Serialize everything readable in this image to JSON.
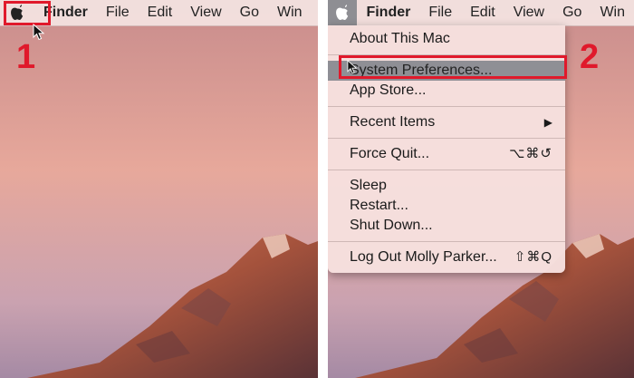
{
  "menubar": {
    "left": {
      "items": [
        "Finder",
        "File",
        "Edit",
        "View",
        "Go",
        "Win"
      ]
    },
    "right": {
      "items": [
        "Finder",
        "File",
        "Edit",
        "View",
        "Go",
        "Win"
      ]
    }
  },
  "steps": {
    "one": "1",
    "two": "2"
  },
  "apple_menu": {
    "about": "About This Mac",
    "system_prefs": "System Preferences...",
    "app_store": "App Store...",
    "recent_items": "Recent Items",
    "recent_arrow": "▶",
    "force_quit": "Force Quit...",
    "force_quit_shortcut": "⌥⌘↺",
    "sleep": "Sleep",
    "restart": "Restart...",
    "shutdown": "Shut Down...",
    "logout": "Log Out Molly Parker...",
    "logout_shortcut": "⇧⌘Q"
  },
  "colors": {
    "accent_red": "#e0192b",
    "highlight": "#8f8f95"
  },
  "icons": {
    "apple": "apple-logo-icon",
    "cursor": "arrow-cursor-icon",
    "submenu": "chevron-right-icon"
  }
}
